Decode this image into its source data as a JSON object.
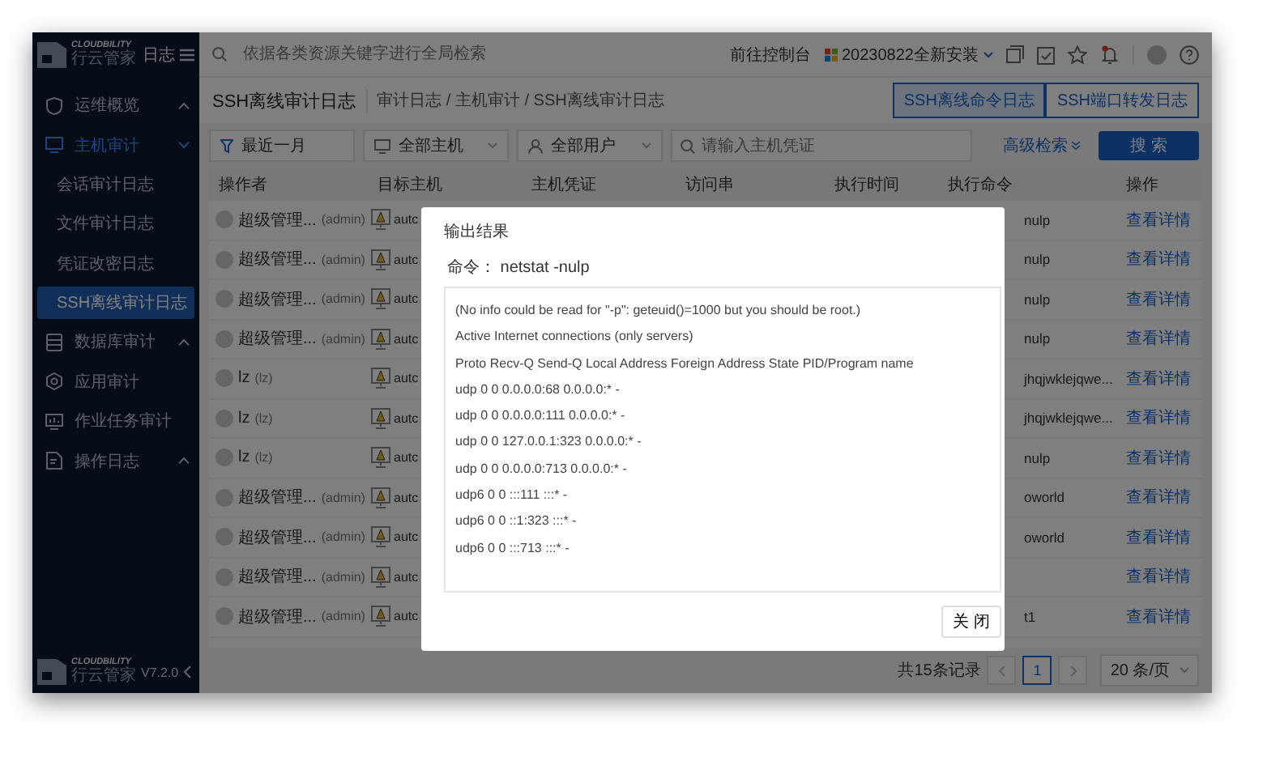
{
  "sidebar": {
    "brand": {
      "name": "CLOUDBILITY",
      "subtitle": "行云管家",
      "section": "日志"
    },
    "items": [
      {
        "label": "运维概览",
        "selected": false,
        "expanded": false
      },
      {
        "label": "主机审计",
        "selected": true,
        "expanded": true,
        "children": [
          {
            "label": "会话审计日志",
            "selected": false
          },
          {
            "label": "文件审计日志",
            "selected": false
          },
          {
            "label": "凭证改密日志",
            "selected": false
          },
          {
            "label": "SSH离线审计日志",
            "selected": true
          }
        ]
      },
      {
        "label": "数据库审计",
        "selected": false,
        "expanded": false
      },
      {
        "label": "应用审计",
        "selected": false
      },
      {
        "label": "作业任务审计",
        "selected": false
      },
      {
        "label": "操作日志",
        "selected": false,
        "expanded": false
      }
    ],
    "footer": {
      "name": "CLOUDBILITY",
      "subtitle": "行云管家",
      "version": "V7.2.0"
    }
  },
  "topbar": {
    "search_placeholder": "依据各类资源关键字进行全局检索",
    "console_link": "前往控制台",
    "project": "20230822全新安装",
    "has_notification": true
  },
  "header": {
    "title": "SSH离线审计日志",
    "breadcrumb": "审计日志 / 主机审计 / SSH离线审计日志",
    "tabs": [
      {
        "label": "SSH离线命令日志",
        "selected": true
      },
      {
        "label": "SSH端口转发日志",
        "selected": false
      }
    ]
  },
  "filters": {
    "time": "最近一月",
    "host": "全部主机",
    "user": "全部用户",
    "credential_placeholder": "请输入主机凭证",
    "advanced": "高级检索",
    "search_button": "搜 索"
  },
  "table": {
    "columns": [
      "操作者",
      "目标主机",
      "主机凭证",
      "访问串",
      "执行时间",
      "执行命令",
      "操作"
    ],
    "rows": [
      {
        "operator": "超级管理...",
        "account": "(admin)",
        "host": "autc",
        "command": "nulp",
        "action": "查看详情"
      },
      {
        "operator": "超级管理...",
        "account": "(admin)",
        "host": "autc",
        "command": "nulp",
        "action": "查看详情"
      },
      {
        "operator": "超级管理...",
        "account": "(admin)",
        "host": "autc",
        "command": "nulp",
        "action": "查看详情"
      },
      {
        "operator": "超级管理...",
        "account": "(admin)",
        "host": "autc",
        "command": "nulp",
        "action": "查看详情"
      },
      {
        "operator": "lz",
        "account": "(lz)",
        "host": "autc",
        "command": "jhqjwklejqwe...",
        "action": "查看详情"
      },
      {
        "operator": "lz",
        "account": "(lz)",
        "host": "autc",
        "command": "jhqjwklejqwe...",
        "action": "查看详情"
      },
      {
        "operator": "lz",
        "account": "(lz)",
        "host": "autc",
        "command": "nulp",
        "action": "查看详情"
      },
      {
        "operator": "超级管理...",
        "account": "(admin)",
        "host": "autc",
        "command": "oworld",
        "action": "查看详情"
      },
      {
        "operator": "超级管理...",
        "account": "(admin)",
        "host": "autc",
        "command": "oworld",
        "action": "查看详情"
      },
      {
        "operator": "超级管理...",
        "account": "(admin)",
        "host": "autc",
        "action": "查看详情"
      },
      {
        "operator": "超级管理...",
        "account": "(admin)",
        "host": "autc",
        "command": "t1",
        "action": "查看详情"
      }
    ]
  },
  "pagination": {
    "total": "共15条记录",
    "pages": [
      {
        "label": "1",
        "selected": true
      }
    ],
    "page_size": "20 条/页"
  },
  "dialog": {
    "title": "输出结果",
    "command_label": "命令：",
    "command": "netstat -nulp",
    "output": [
      "(No info could be read for \"-p\": geteuid()=1000 but you should be root.)",
      "Active Internet connections (only servers)",
      "Proto Recv-Q Send-Q Local Address Foreign Address State PID/Program name",
      "udp 0 0 0.0.0.0:68 0.0.0.0:* -",
      "udp 0 0 0.0.0.0:111 0.0.0.0:* -",
      "udp 0 0 127.0.0.1:323 0.0.0.0:* -",
      "udp 0 0 0.0.0.0:713 0.0.0.0:* -",
      "udp6 0 0 :::111 :::* -",
      "udp6 0 0 ::1:323 :::* -",
      "udp6 0 0 :::713 :::* -"
    ],
    "close_button": "关 闭"
  }
}
